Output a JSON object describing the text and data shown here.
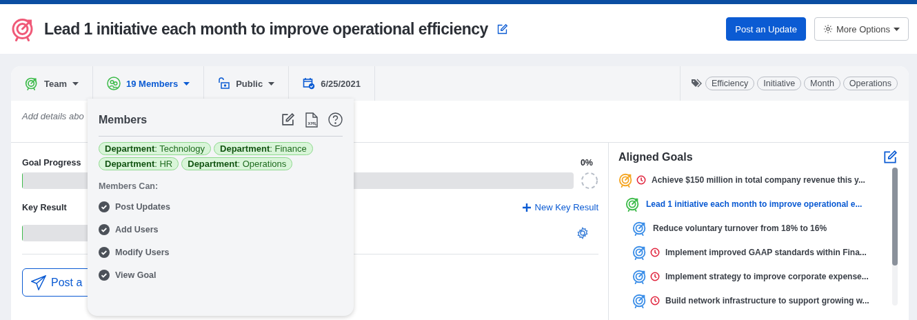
{
  "header": {
    "title": "Lead 1 initiative each month to improve operational efficiency",
    "buttons": [
      {
        "label": "Post an Update",
        "kind": "primary"
      },
      {
        "label": "More Options",
        "kind": "options"
      }
    ]
  },
  "toolbar": {
    "items": [
      {
        "label": "Team",
        "kind": "team"
      },
      {
        "label": "19 Members",
        "kind": "members",
        "expanded": true
      },
      {
        "label": "Public",
        "kind": "visibility"
      },
      {
        "label": "6/25/2021",
        "kind": "date"
      }
    ],
    "tags": [
      "Efficiency",
      "Initiative",
      "Month",
      "Operations"
    ]
  },
  "details": {
    "placeholder": "Add details abo"
  },
  "goal_progress": {
    "label": "Goal Progress",
    "reading": "0%",
    "level": 0
  },
  "key_result": {
    "label": "Key Result",
    "add_link": "New Key Result",
    "level": 0
  },
  "post_button": {
    "label": "Post a"
  },
  "members_popup": {
    "title": "Members",
    "chips": [
      "**Department**: Technology",
      "**Department**: Finance",
      "**Department**: HR",
      "**Department**: Operations"
    ],
    "permissions_title": "Members Can:",
    "permissions": [
      {
        "label": "Post Updates",
        "checked": true
      },
      {
        "label": "Add Users",
        "checked": true
      },
      {
        "label": "Modify Users",
        "checked": true
      },
      {
        "label": "View Goal",
        "checked": true
      }
    ]
  },
  "aligned_goals": {
    "title": "Aligned Goals",
    "items": [
      {
        "label": "Achieve $150 million in total company revenue this y...",
        "color": "#f5a623",
        "overdue": true,
        "selected": false,
        "children": [
          {
            "label": "Lead 1 initiative each month to improve operational e...",
            "color": "#3dbb4a",
            "overdue": false,
            "selected": true,
            "children": [
              {
                "label": "Reduce voluntary turnover from 18% to 16%",
                "color": "#3b8ee8",
                "overdue": false,
                "selected": false
              },
              {
                "label": "Implement improved GAAP standards within Fina...",
                "color": "#3b8ee8",
                "overdue": true,
                "selected": false
              },
              {
                "label": "Implement strategy to improve corporate expense...",
                "color": "#3b8ee8",
                "overdue": true,
                "selected": false
              },
              {
                "label": "Build network infrastructure to support growing w...",
                "color": "#3b8ee8",
                "overdue": true,
                "selected": false
              }
            ]
          }
        ]
      }
    ]
  }
}
